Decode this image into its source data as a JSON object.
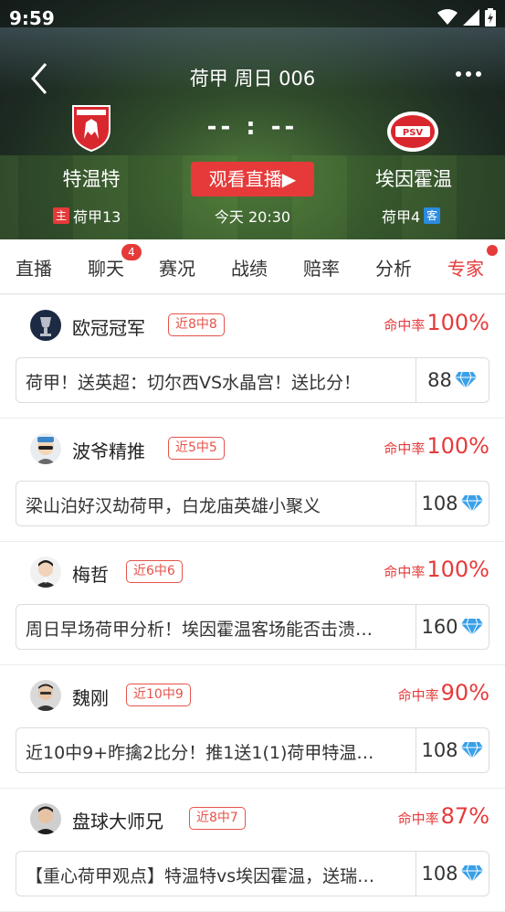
{
  "status_bar": {
    "time": "9:59"
  },
  "header": {
    "title": "荷甲 周日 006",
    "score": "-- : --",
    "watch_button": "观看直播▶",
    "match_time": "今天 20:30",
    "home": {
      "name": "特温特",
      "tag": "主",
      "rank": "荷甲13",
      "color": "#d9272e"
    },
    "away": {
      "name": "埃因霍温",
      "tag": "客",
      "rank": "荷甲4",
      "color": "#d9272e"
    }
  },
  "tabs": [
    {
      "label": "直播"
    },
    {
      "label": "聊天",
      "badge": "4"
    },
    {
      "label": "赛况"
    },
    {
      "label": "战绩"
    },
    {
      "label": "赔率"
    },
    {
      "label": "分析"
    },
    {
      "label": "专家",
      "active": true
    }
  ],
  "experts": [
    {
      "name": "欧冠冠军",
      "streak": "近8中8",
      "hit_label": "命中率",
      "hit_value": "100%",
      "post": "荷甲！送英超：切尔西VS水晶宫！送比分！",
      "price": "88"
    },
    {
      "name": "波爷精推",
      "streak": "近5中5",
      "hit_label": "命中率",
      "hit_value": "100%",
      "post": "梁山泊好汉劫荷甲，白龙庙英雄小聚义",
      "price": "108"
    },
    {
      "name": "梅哲",
      "streak": "近6中6",
      "hit_label": "命中率",
      "hit_value": "100%",
      "post": "周日早场荷甲分析！埃因霍温客场能否击溃…",
      "price": "160"
    },
    {
      "name": "魏刚",
      "streak": "近10中9",
      "hit_label": "命中率",
      "hit_value": "90%",
      "post": "近10中9+昨擒2比分！推1送1(1)荷甲特温…",
      "price": "108"
    },
    {
      "name": "盘球大师兄",
      "streak": "近8中7",
      "hit_label": "命中率",
      "hit_value": "87%",
      "post": "【重心荷甲观点】特温特vs埃因霍温，送瑞…",
      "price": "108"
    }
  ],
  "colors": {
    "accent": "#e63a3a",
    "diamond": "#3aa0e8"
  }
}
